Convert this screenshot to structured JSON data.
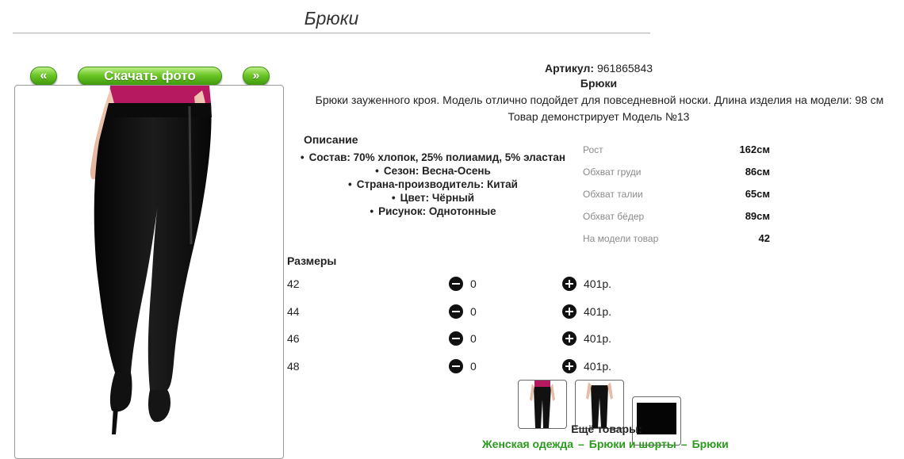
{
  "page": {
    "title": "Брюки"
  },
  "gallery": {
    "prev_label": "«",
    "download_label": "Скачать фото",
    "next_label": "»"
  },
  "product": {
    "article_label": "Артикул:",
    "article_value": "961865843",
    "name": "Брюки",
    "description": "Брюки зауженного кроя. Модель отлично подойдет для повседневной носки. Длина изделия на модели: 98 см",
    "model_note": "Товар демонстрирует Модель №13"
  },
  "details": {
    "title": "Описание",
    "items": [
      "Состав: 70% хлопок, 25% полиамид, 5% эластан",
      "Сезон: Весна-Осень",
      "Страна-производитель: Китай",
      "Цвет: Чёрный",
      "Рисунок: Однотонные"
    ]
  },
  "model_params": [
    {
      "label": "Рост",
      "value": "162см"
    },
    {
      "label": "Обхват груди",
      "value": "86см"
    },
    {
      "label": "Обхват талии",
      "value": "65см"
    },
    {
      "label": "Обхват бёдер",
      "value": "89см"
    },
    {
      "label": "На модели товар",
      "value": "42"
    }
  ],
  "sizes": {
    "title": "Размеры",
    "rows": [
      {
        "size": "42",
        "qty": "0",
        "price": "401р."
      },
      {
        "size": "44",
        "qty": "0",
        "price": "401р."
      },
      {
        "size": "46",
        "qty": "0",
        "price": "401р."
      },
      {
        "size": "48",
        "qty": "0",
        "price": "401р."
      }
    ]
  },
  "more": {
    "title": "Ещё товары:",
    "links": [
      "Женская одежда",
      "Брюки и шорты",
      "Брюки"
    ],
    "separator": "–"
  },
  "colors": {
    "accent_green": "#4cae17",
    "link_green": "#2a9a1c"
  }
}
